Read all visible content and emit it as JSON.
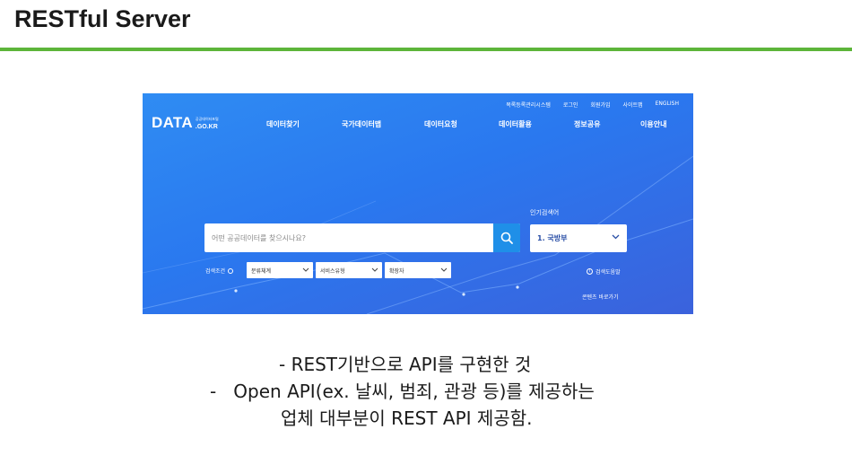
{
  "slide": {
    "title": "RESTful Server",
    "accent_color": "#5db53a"
  },
  "screenshot": {
    "util_links": [
      "목록등록관리시스템",
      "로그인",
      "회원가입",
      "사이트맵",
      "ENGLISH"
    ],
    "logo": {
      "main": "DATA",
      "sub": "공공데이터포털",
      "domain": ".GO.KR"
    },
    "nav": [
      "데이터찾기",
      "국가데이터맵",
      "데이터요청",
      "데이터활용",
      "정보공유",
      "이용안내"
    ],
    "search": {
      "placeholder": "어떤 공공데이터를 찾으시나요?",
      "icon": "search-icon"
    },
    "popular": {
      "label": "인기검색어",
      "selected": "1. 국방부"
    },
    "conditions": {
      "label": "검색조건",
      "dropdowns": [
        "분류체계",
        "서비스유형",
        "확장자"
      ]
    },
    "help_link": "검색도움말",
    "content_link": "콘텐츠 바로가기",
    "colors": {
      "background": "#2a78ef",
      "search_button": "#1f8fe8"
    }
  },
  "bullets": [
    "- REST기반으로 API를 구현한 것",
    "-   Open API(ex. 날씨, 범죄, 관광 등)를 제공하는",
    "업체 대부분이 REST API 제공함."
  ]
}
